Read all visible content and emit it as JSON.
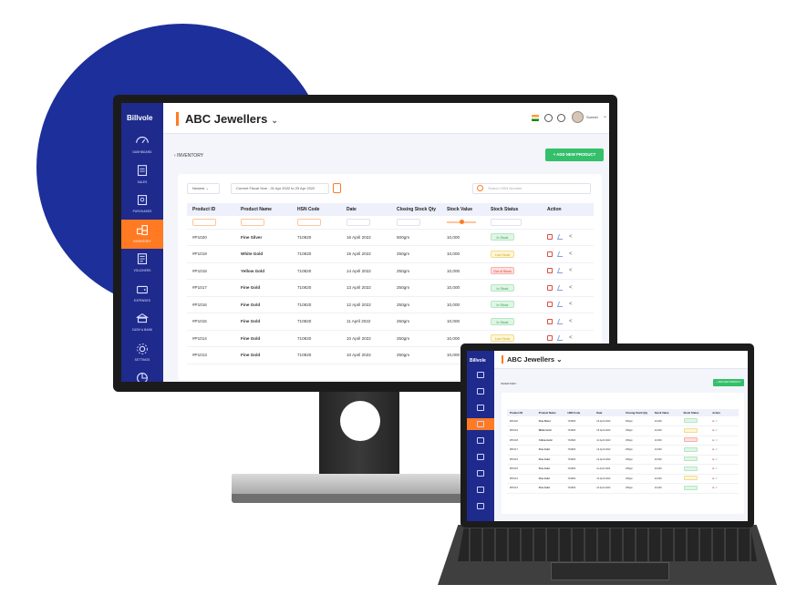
{
  "app": {
    "logo_text": "Billvole",
    "company_name": "ABC Jewellers",
    "user_name": "Suresh",
    "accent_color": "#ff7a22",
    "sidebar_color": "#1e2a8c"
  },
  "sidebar": {
    "items": [
      {
        "label": "DASHBOARD",
        "icon": "gauge-icon"
      },
      {
        "label": "SALES",
        "icon": "receipt-icon"
      },
      {
        "label": "PURCHASES",
        "icon": "cart-icon"
      },
      {
        "label": "INVENTORY",
        "icon": "boxes-icon",
        "active": true
      },
      {
        "label": "VOUCHERS",
        "icon": "voucher-icon"
      },
      {
        "label": "EXPENSES",
        "icon": "wallet-icon"
      },
      {
        "label": "CASH & BANK",
        "icon": "bank-icon"
      },
      {
        "label": "SETTINGS",
        "icon": "settings-icon"
      },
      {
        "label": "REPORTS",
        "icon": "report-icon"
      }
    ]
  },
  "page": {
    "breadcrumb": "INVENTORY",
    "add_button": "+ ADD NEW PRODUCT"
  },
  "filters": {
    "sort": "Newest",
    "date_range": "Current Fiscal Year - 01 Apr 2022 to 23 Apr 2022",
    "search_placeholder": "Search HSN Number"
  },
  "table": {
    "columns": [
      "Product ID",
      "Product Name",
      "HSN Code",
      "Date",
      "Closing Stock Qty",
      "Stock Value",
      "Stock Status",
      "Action"
    ],
    "rows": [
      {
        "id": "#P1020",
        "name": "Fine Silver",
        "hsn": "710820",
        "date": "16 April 2022",
        "qty": "500gm",
        "value": "10,000",
        "status": "In Stock",
        "kind": "in"
      },
      {
        "id": "#P1019",
        "name": "White Gold",
        "hsn": "710820",
        "date": "15 April 2022",
        "qty": "250gm",
        "value": "10,000",
        "status": "Low Stock",
        "kind": "low"
      },
      {
        "id": "#P1018",
        "name": "Yellow Gold",
        "hsn": "710820",
        "date": "14 April 2022",
        "qty": "250gm",
        "value": "10,000",
        "status": "Out of Stock",
        "kind": "out"
      },
      {
        "id": "#P1017",
        "name": "Fine Gold",
        "hsn": "710820",
        "date": "13 April 2022",
        "qty": "250gm",
        "value": "10,000",
        "status": "In Stock",
        "kind": "in"
      },
      {
        "id": "#P1016",
        "name": "Fine Gold",
        "hsn": "710820",
        "date": "12 April 2022",
        "qty": "250gm",
        "value": "10,000",
        "status": "In Stock",
        "kind": "in"
      },
      {
        "id": "#P1015",
        "name": "Fine Gold",
        "hsn": "710820",
        "date": "11 April 2022",
        "qty": "250gm",
        "value": "10,000",
        "status": "In Stock",
        "kind": "in"
      },
      {
        "id": "#P1014",
        "name": "Fine Gold",
        "hsn": "710820",
        "date": "10 April 2022",
        "qty": "250gm",
        "value": "10,000",
        "status": "Low Stock",
        "kind": "low"
      },
      {
        "id": "#P1013",
        "name": "Fine Gold",
        "hsn": "710820",
        "date": "10 April 2022",
        "qty": "250gm",
        "value": "10,000",
        "status": "In Stock",
        "kind": "in"
      }
    ]
  }
}
